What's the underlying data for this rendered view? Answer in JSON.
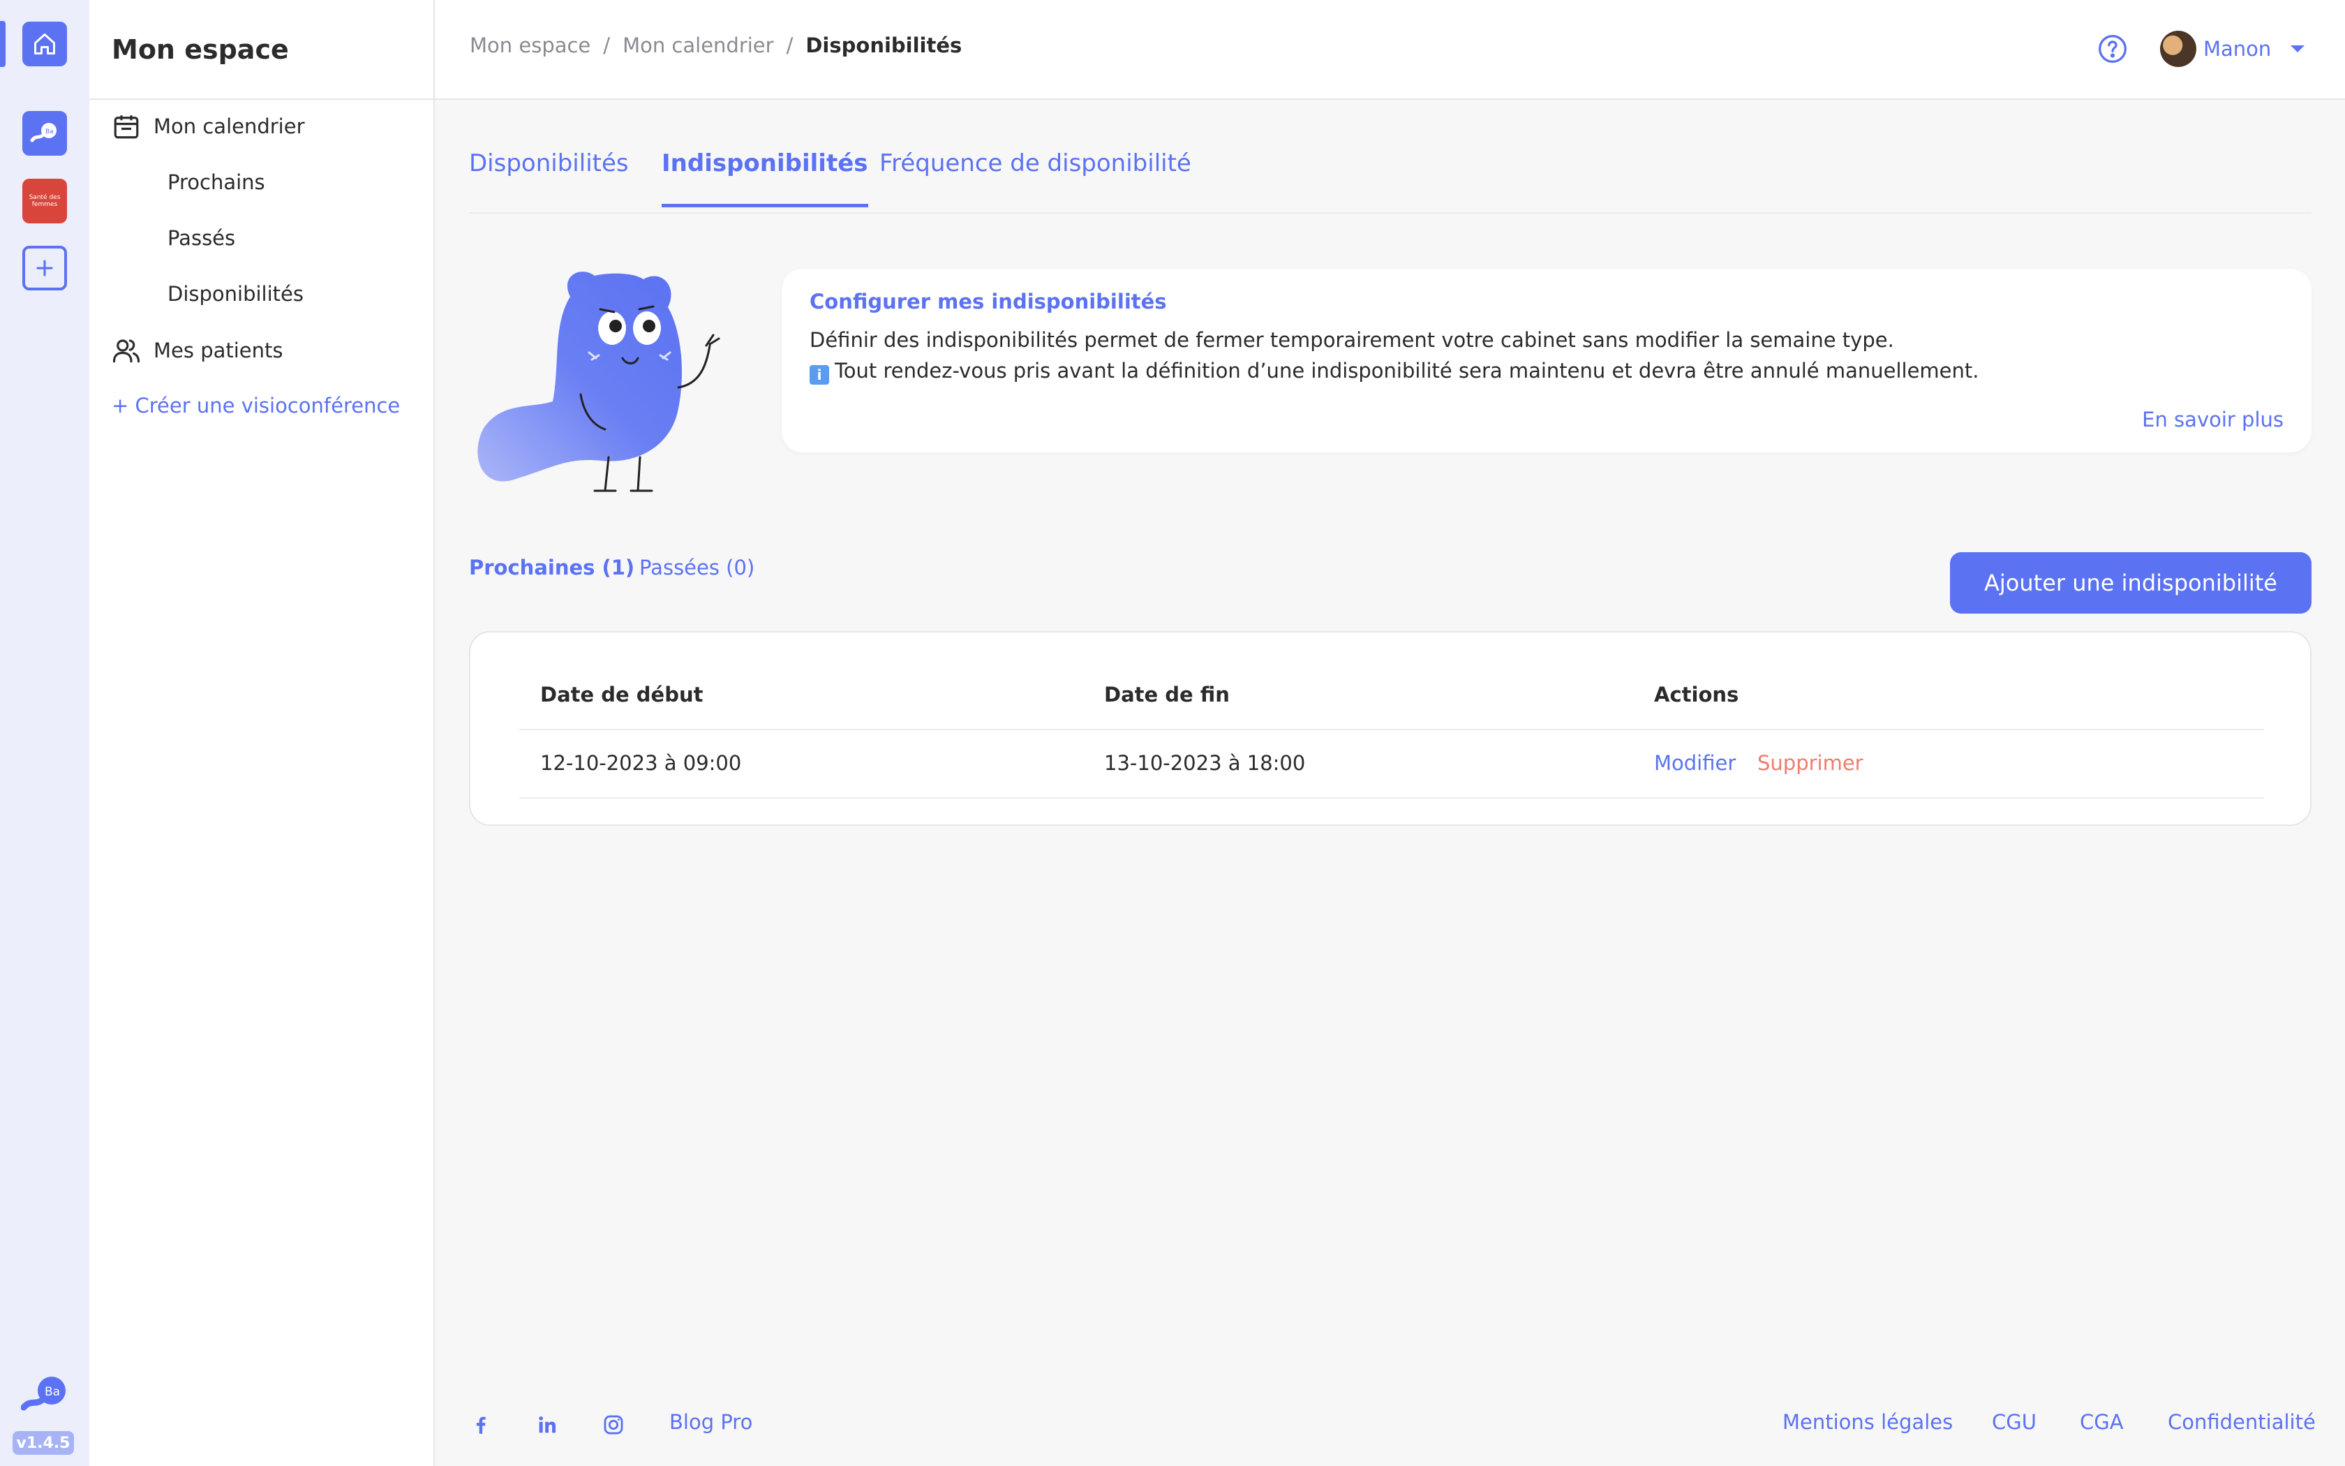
{
  "rail": {
    "app2_text": "Santé des femmes",
    "version": "v1.4.5"
  },
  "sidebar": {
    "title": "Mon espace",
    "calendar": "Mon calendrier",
    "sub_items": [
      "Prochains",
      "Passés",
      "Disponibilités"
    ],
    "patients": "Mes patients",
    "create_visio": "+ Créer une visioconférence"
  },
  "breadcrumb": [
    "Mon espace",
    "Mon calendrier",
    "Disponibilités"
  ],
  "user": {
    "name": "Manon"
  },
  "tabs": [
    "Disponibilités",
    "Indisponibilités",
    "Fréquence de disponibilité"
  ],
  "info": {
    "title": "Configurer mes indisponibilités",
    "line1": "Définir des indisponibilités permet de fermer temporairement votre cabinet sans modifier la semaine type.",
    "line2": "Tout rendez-vous pris avant la définition d’une indisponibilité sera maintenu et devra être annulé manuellement.",
    "more": "En savoir plus"
  },
  "subtabs": [
    "Prochaines (1)",
    "Passées (0)"
  ],
  "add_button": "Ajouter une indisponibilité",
  "table": {
    "headers": [
      "Date de début",
      "Date de fin",
      "Actions"
    ],
    "rows": [
      {
        "start": "12-10-2023 à 09:00",
        "end": "13-10-2023 à 18:00",
        "edit": "Modifier",
        "delete": "Supprimer"
      }
    ]
  },
  "footer": {
    "blog": "Blog Pro",
    "links": [
      "Mentions légales",
      "CGU",
      "CGA",
      "Confidentialité"
    ]
  },
  "colors": {
    "accent": "#5b72f2",
    "danger": "#f07b6e",
    "rail_bg": "#eceefb"
  }
}
